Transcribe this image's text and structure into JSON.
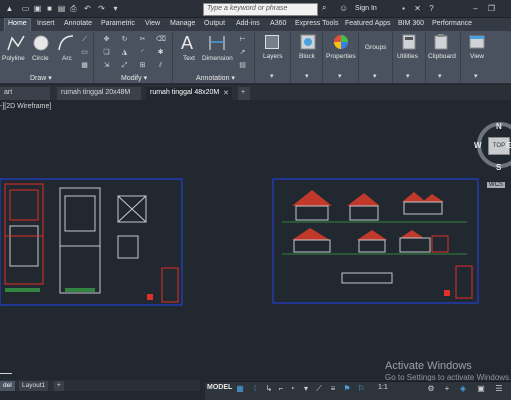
{
  "search": {
    "placeholder": "Type a keyword or phrase"
  },
  "account": {
    "signin_label": "Sign In"
  },
  "ribbon_tabs": [
    "Home",
    "Insert",
    "Annotate",
    "Parametric",
    "View",
    "Manage",
    "Output",
    "Add-ins",
    "A360",
    "Express Tools",
    "Featured Apps",
    "BIM 360",
    "Performance"
  ],
  "ribbon": {
    "draw": {
      "title": "Draw",
      "polyline": "Polyline",
      "circle": "Circle",
      "arc": "Arc"
    },
    "modify": {
      "title": "Modify"
    },
    "annotation": {
      "title": "Annotation",
      "text": "Text",
      "dimension": "Dimension"
    },
    "layers": "Layers",
    "block": "Block",
    "properties": "Properties",
    "groups": "Groups",
    "utilities": "Utilities",
    "clipboard": "Clipboard",
    "view": "View"
  },
  "doc_tabs": [
    "art",
    "rumah tinggal 20x48M",
    "rumah tinggal 48x20M",
    "+"
  ],
  "viewport_label": "-][2D Wireframe]",
  "viewcube": {
    "top": "TOP",
    "north": "N",
    "west": "W",
    "east": "E",
    "south": "S",
    "wcs": "WCS"
  },
  "layout_tabs": [
    "del",
    "Layout1",
    "+"
  ],
  "status": {
    "model": "MODEL",
    "scale": "1:1"
  },
  "watermark": {
    "title": "Activate Windows",
    "subtitle": "Go to Settings to activate Windows."
  },
  "colors": {
    "frame_blue": "#1f3fcf",
    "drawing_red": "#e0302a",
    "accent": "#4aa3e0",
    "canvas": "#212830"
  }
}
